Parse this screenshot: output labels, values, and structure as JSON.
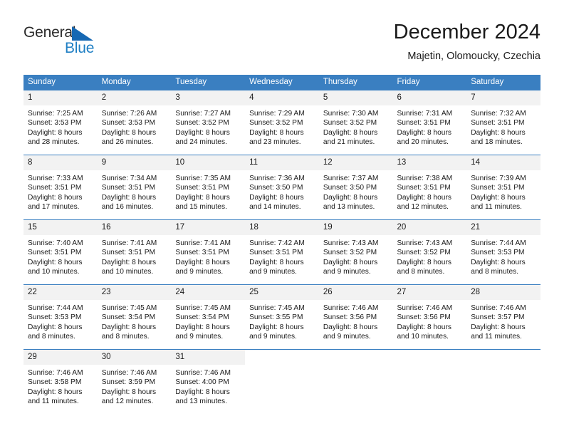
{
  "logo": {
    "name_part1": "General",
    "name_part2": "Blue",
    "triangle_color": "#1668b3",
    "blue_color": "#1f7fc4"
  },
  "header": {
    "title": "December 2024",
    "subtitle": "Majetin, Olomoucky, Czechia"
  },
  "theme": {
    "header_bar_color": "#3a7fc1",
    "daynum_row_color": "#f2f2f2",
    "text_color": "#1a1a1a"
  },
  "calendar": {
    "day_headers": [
      "Sunday",
      "Monday",
      "Tuesday",
      "Wednesday",
      "Thursday",
      "Friday",
      "Saturday"
    ],
    "weeks": [
      [
        {
          "day": "1",
          "sunrise": "Sunrise: 7:25 AM",
          "sunset": "Sunset: 3:53 PM",
          "daylight_line1": "Daylight: 8 hours",
          "daylight_line2": "and 28 minutes."
        },
        {
          "day": "2",
          "sunrise": "Sunrise: 7:26 AM",
          "sunset": "Sunset: 3:53 PM",
          "daylight_line1": "Daylight: 8 hours",
          "daylight_line2": "and 26 minutes."
        },
        {
          "day": "3",
          "sunrise": "Sunrise: 7:27 AM",
          "sunset": "Sunset: 3:52 PM",
          "daylight_line1": "Daylight: 8 hours",
          "daylight_line2": "and 24 minutes."
        },
        {
          "day": "4",
          "sunrise": "Sunrise: 7:29 AM",
          "sunset": "Sunset: 3:52 PM",
          "daylight_line1": "Daylight: 8 hours",
          "daylight_line2": "and 23 minutes."
        },
        {
          "day": "5",
          "sunrise": "Sunrise: 7:30 AM",
          "sunset": "Sunset: 3:52 PM",
          "daylight_line1": "Daylight: 8 hours",
          "daylight_line2": "and 21 minutes."
        },
        {
          "day": "6",
          "sunrise": "Sunrise: 7:31 AM",
          "sunset": "Sunset: 3:51 PM",
          "daylight_line1": "Daylight: 8 hours",
          "daylight_line2": "and 20 minutes."
        },
        {
          "day": "7",
          "sunrise": "Sunrise: 7:32 AM",
          "sunset": "Sunset: 3:51 PM",
          "daylight_line1": "Daylight: 8 hours",
          "daylight_line2": "and 18 minutes."
        }
      ],
      [
        {
          "day": "8",
          "sunrise": "Sunrise: 7:33 AM",
          "sunset": "Sunset: 3:51 PM",
          "daylight_line1": "Daylight: 8 hours",
          "daylight_line2": "and 17 minutes."
        },
        {
          "day": "9",
          "sunrise": "Sunrise: 7:34 AM",
          "sunset": "Sunset: 3:51 PM",
          "daylight_line1": "Daylight: 8 hours",
          "daylight_line2": "and 16 minutes."
        },
        {
          "day": "10",
          "sunrise": "Sunrise: 7:35 AM",
          "sunset": "Sunset: 3:51 PM",
          "daylight_line1": "Daylight: 8 hours",
          "daylight_line2": "and 15 minutes."
        },
        {
          "day": "11",
          "sunrise": "Sunrise: 7:36 AM",
          "sunset": "Sunset: 3:50 PM",
          "daylight_line1": "Daylight: 8 hours",
          "daylight_line2": "and 14 minutes."
        },
        {
          "day": "12",
          "sunrise": "Sunrise: 7:37 AM",
          "sunset": "Sunset: 3:50 PM",
          "daylight_line1": "Daylight: 8 hours",
          "daylight_line2": "and 13 minutes."
        },
        {
          "day": "13",
          "sunrise": "Sunrise: 7:38 AM",
          "sunset": "Sunset: 3:51 PM",
          "daylight_line1": "Daylight: 8 hours",
          "daylight_line2": "and 12 minutes."
        },
        {
          "day": "14",
          "sunrise": "Sunrise: 7:39 AM",
          "sunset": "Sunset: 3:51 PM",
          "daylight_line1": "Daylight: 8 hours",
          "daylight_line2": "and 11 minutes."
        }
      ],
      [
        {
          "day": "15",
          "sunrise": "Sunrise: 7:40 AM",
          "sunset": "Sunset: 3:51 PM",
          "daylight_line1": "Daylight: 8 hours",
          "daylight_line2": "and 10 minutes."
        },
        {
          "day": "16",
          "sunrise": "Sunrise: 7:41 AM",
          "sunset": "Sunset: 3:51 PM",
          "daylight_line1": "Daylight: 8 hours",
          "daylight_line2": "and 10 minutes."
        },
        {
          "day": "17",
          "sunrise": "Sunrise: 7:41 AM",
          "sunset": "Sunset: 3:51 PM",
          "daylight_line1": "Daylight: 8 hours",
          "daylight_line2": "and 9 minutes."
        },
        {
          "day": "18",
          "sunrise": "Sunrise: 7:42 AM",
          "sunset": "Sunset: 3:51 PM",
          "daylight_line1": "Daylight: 8 hours",
          "daylight_line2": "and 9 minutes."
        },
        {
          "day": "19",
          "sunrise": "Sunrise: 7:43 AM",
          "sunset": "Sunset: 3:52 PM",
          "daylight_line1": "Daylight: 8 hours",
          "daylight_line2": "and 9 minutes."
        },
        {
          "day": "20",
          "sunrise": "Sunrise: 7:43 AM",
          "sunset": "Sunset: 3:52 PM",
          "daylight_line1": "Daylight: 8 hours",
          "daylight_line2": "and 8 minutes."
        },
        {
          "day": "21",
          "sunrise": "Sunrise: 7:44 AM",
          "sunset": "Sunset: 3:53 PM",
          "daylight_line1": "Daylight: 8 hours",
          "daylight_line2": "and 8 minutes."
        }
      ],
      [
        {
          "day": "22",
          "sunrise": "Sunrise: 7:44 AM",
          "sunset": "Sunset: 3:53 PM",
          "daylight_line1": "Daylight: 8 hours",
          "daylight_line2": "and 8 minutes."
        },
        {
          "day": "23",
          "sunrise": "Sunrise: 7:45 AM",
          "sunset": "Sunset: 3:54 PM",
          "daylight_line1": "Daylight: 8 hours",
          "daylight_line2": "and 8 minutes."
        },
        {
          "day": "24",
          "sunrise": "Sunrise: 7:45 AM",
          "sunset": "Sunset: 3:54 PM",
          "daylight_line1": "Daylight: 8 hours",
          "daylight_line2": "and 9 minutes."
        },
        {
          "day": "25",
          "sunrise": "Sunrise: 7:45 AM",
          "sunset": "Sunset: 3:55 PM",
          "daylight_line1": "Daylight: 8 hours",
          "daylight_line2": "and 9 minutes."
        },
        {
          "day": "26",
          "sunrise": "Sunrise: 7:46 AM",
          "sunset": "Sunset: 3:56 PM",
          "daylight_line1": "Daylight: 8 hours",
          "daylight_line2": "and 9 minutes."
        },
        {
          "day": "27",
          "sunrise": "Sunrise: 7:46 AM",
          "sunset": "Sunset: 3:56 PM",
          "daylight_line1": "Daylight: 8 hours",
          "daylight_line2": "and 10 minutes."
        },
        {
          "day": "28",
          "sunrise": "Sunrise: 7:46 AM",
          "sunset": "Sunset: 3:57 PM",
          "daylight_line1": "Daylight: 8 hours",
          "daylight_line2": "and 11 minutes."
        }
      ],
      [
        {
          "day": "29",
          "sunrise": "Sunrise: 7:46 AM",
          "sunset": "Sunset: 3:58 PM",
          "daylight_line1": "Daylight: 8 hours",
          "daylight_line2": "and 11 minutes."
        },
        {
          "day": "30",
          "sunrise": "Sunrise: 7:46 AM",
          "sunset": "Sunset: 3:59 PM",
          "daylight_line1": "Daylight: 8 hours",
          "daylight_line2": "and 12 minutes."
        },
        {
          "day": "31",
          "sunrise": "Sunrise: 7:46 AM",
          "sunset": "Sunset: 4:00 PM",
          "daylight_line1": "Daylight: 8 hours",
          "daylight_line2": "and 13 minutes."
        },
        {
          "day": "",
          "sunrise": "",
          "sunset": "",
          "daylight_line1": "",
          "daylight_line2": ""
        },
        {
          "day": "",
          "sunrise": "",
          "sunset": "",
          "daylight_line1": "",
          "daylight_line2": ""
        },
        {
          "day": "",
          "sunrise": "",
          "sunset": "",
          "daylight_line1": "",
          "daylight_line2": ""
        },
        {
          "day": "",
          "sunrise": "",
          "sunset": "",
          "daylight_line1": "",
          "daylight_line2": ""
        }
      ]
    ]
  }
}
